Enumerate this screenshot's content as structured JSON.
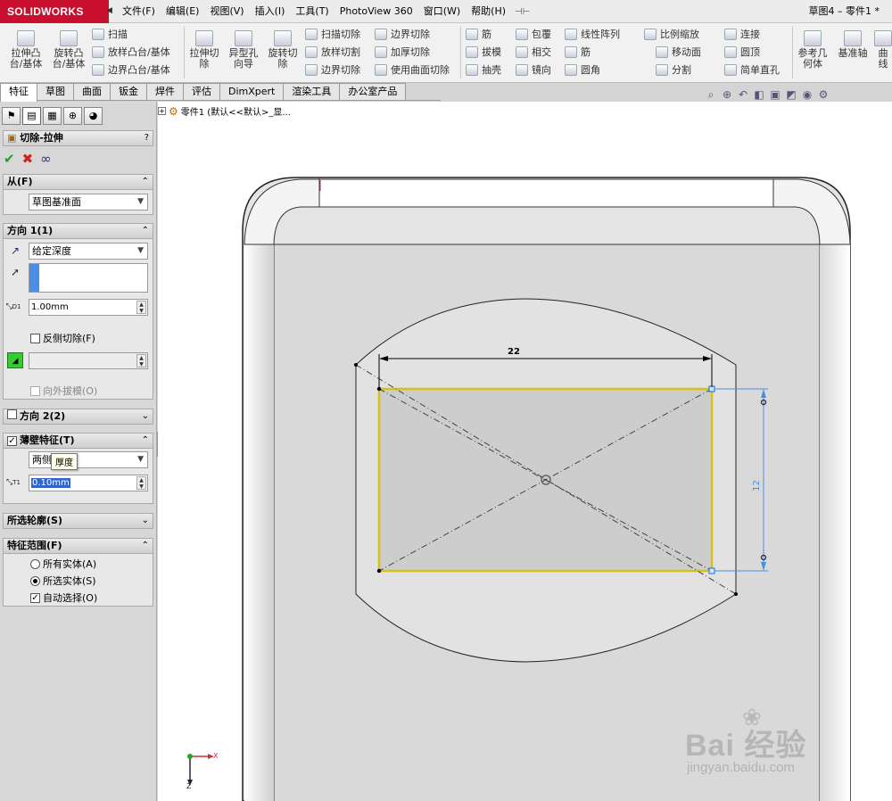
{
  "app": {
    "brand": "SOLIDWORKS",
    "document_title": "草图4 – 零件1 *"
  },
  "menu": [
    "文件(F)",
    "编辑(E)",
    "视图(V)",
    "插入(I)",
    "工具(T)",
    "PhotoView 360",
    "窗口(W)",
    "帮助(H)"
  ],
  "toolbar": {
    "extrude_boss": "拉伸凸台/基体",
    "revolve_boss": "旋转凸台/基体",
    "sweep": "扫描",
    "loft_boss": "放样凸台/基体",
    "boundary_boss": "边界凸台/基体",
    "extrude_cut": "拉伸切除",
    "hole_wizard": "异型孔向导",
    "revolve_cut": "旋转切除",
    "swept_cut": "扫描切除",
    "lofted_cut": "放样切割",
    "boundary_cut": "边界切除",
    "boundary_cut2": "边界切除",
    "thicken_cut": "加厚切除",
    "surface_cut": "使用曲面切除",
    "fillet": "筋",
    "draft": "拔模",
    "shell": "抽壳",
    "wrap": "包覆",
    "intersect": "相交",
    "mirror": "镜向",
    "linear_pattern": "线性阵列",
    "rib": "筋",
    "round": "圆角",
    "scale": "比例缩放",
    "move_face": "移动面",
    "split": "分割",
    "connect": "连接",
    "dome": "圆顶",
    "simple_hole": "简单直孔",
    "ref_geometry": "参考几何体",
    "ref_axis": "基准轴",
    "curves": "曲线"
  },
  "tabs": [
    "特征",
    "草图",
    "曲面",
    "钣金",
    "焊件",
    "评估",
    "DimXpert",
    "渲染工具",
    "办公室产品"
  ],
  "panel": {
    "feature_title": "切除-拉伸",
    "help": "?",
    "from": {
      "title": "从(F)",
      "value": "草图基准面"
    },
    "direction1": {
      "title": "方向 1(1)",
      "end_condition": "给定深度",
      "depth_label": "D1",
      "depth": "1.00mm",
      "flip_side": "反侧切除(F)",
      "draft_outward": "向外拔模(O)"
    },
    "direction2": {
      "title": "方向 2(2)"
    },
    "thin_feature": {
      "title": "薄壁特征(T)",
      "type": "两侧",
      "tooltip": "厚度",
      "thickness_label": "T1",
      "thickness": "0.10mm"
    },
    "selected_contours": {
      "title": "所选轮廓(S)"
    },
    "feature_scope": {
      "title": "特征范围(F)",
      "all_bodies": "所有实体(A)",
      "selected_bodies": "所选实体(S)",
      "auto_select": "自动选择(O)"
    }
  },
  "viewport": {
    "tree_label": "零件1 (默认<<默认>_显...",
    "dim_width": "22",
    "dim_height": "12",
    "triad_x": "X",
    "triad_z": "Z"
  },
  "watermark": {
    "brand": "Bai 经验",
    "url": "jingyan.baidu.com"
  }
}
